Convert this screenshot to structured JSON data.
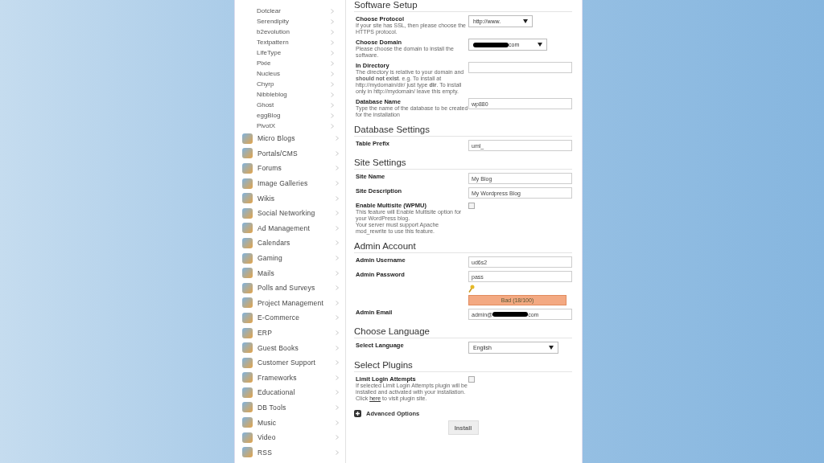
{
  "sidebar": {
    "sub_items": [
      "Dotclear",
      "Serendipity",
      "b2evolution",
      "Textpattern",
      "LifeType",
      "Pixie",
      "Nucleus",
      "Chyrp",
      "Nibbleblog",
      "Ghost",
      "eggBlog",
      "PivotX"
    ],
    "categories": [
      "Micro Blogs",
      "Portals/CMS",
      "Forums",
      "Image Galleries",
      "Wikis",
      "Social Networking",
      "Ad Management",
      "Calendars",
      "Gaming",
      "Mails",
      "Polls and Surveys",
      "Project Management",
      "E-Commerce",
      "ERP",
      "Guest Books",
      "Customer Support",
      "Frameworks",
      "Educational",
      "DB Tools",
      "Music",
      "Video",
      "RSS"
    ]
  },
  "sections": [
    {
      "title": "Software Setup",
      "fields": [
        {
          "kind": "select",
          "label": "Choose Protocol",
          "description": "If your site has SSL, then please choose the HTTPS protocol.",
          "value": "http://www."
        },
        {
          "kind": "select",
          "label": "Choose Domain",
          "description": "Please choose the domain to install the software.",
          "value": "com",
          "redacted": true
        },
        {
          "kind": "text",
          "label": "In Directory",
          "description": "The directory is relative to your domain and **should not exist**. e.g. To install at http://mydomain/dir/ just type **dir**. To install only in http://mydomain/ leave this empty."
        },
        {
          "kind": "text",
          "label": "Database Name",
          "description": "Type the name of the database to be created for the installation",
          "value": "wp880"
        }
      ]
    },
    {
      "title": "Database Settings",
      "fields": [
        {
          "kind": "text",
          "label": "Table Prefix",
          "value": "uml_"
        }
      ]
    },
    {
      "title": "Site Settings",
      "fields": [
        {
          "kind": "text",
          "label": "Site Name",
          "value": "My Blog"
        },
        {
          "kind": "text",
          "label": "Site Description",
          "value": "My Wordpress Blog"
        },
        {
          "kind": "checkbox",
          "label": "Enable Multisite (WPMU)",
          "description": "This feature will Enable Multisite option for your WordPress blog.\nYour server must support Apache mod_rewrite to use this feature.",
          "checked": false
        }
      ]
    },
    {
      "title": "Admin Account",
      "fields": [
        {
          "kind": "text",
          "label": "Admin Username",
          "value": "ud6s2"
        },
        {
          "kind": "password",
          "label": "Admin Password",
          "value": "pass",
          "strength": "Bad (18/100)"
        },
        {
          "kind": "text",
          "label": "Admin Email",
          "value": "admin@",
          "value_end": "com",
          "redacted": true
        }
      ]
    },
    {
      "title": "Choose Language",
      "fields": [
        {
          "kind": "select",
          "label": "Select Language",
          "value": "English"
        }
      ]
    },
    {
      "title": "Select Plugins",
      "fields": [
        {
          "kind": "checkbox",
          "label": "Limit Login Attempts",
          "description": "If selected Limit Login Attempts plugin will be installed and activated with your installation.",
          "link_before": "Click",
          "link": "here",
          "link_after": "to visit plugin site.",
          "checked": false
        }
      ]
    }
  ],
  "advanced_options": "Advanced Options",
  "install_button": "Install"
}
